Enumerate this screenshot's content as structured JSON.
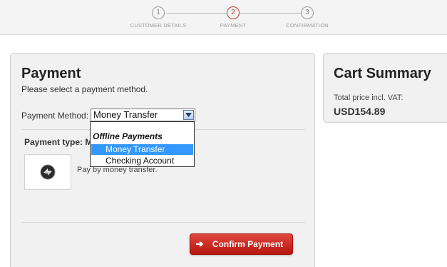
{
  "steps": [
    {
      "number": "1",
      "label": "CUSTOMER DETAILS"
    },
    {
      "number": "2",
      "label": "PAYMENT"
    },
    {
      "number": "3",
      "label": "CONFIRMATION"
    }
  ],
  "active_step": "2",
  "payment": {
    "title": "Payment",
    "subtitle": "Please select a payment method.",
    "method_label": "Payment Method:",
    "selected_method": "Money Transfer",
    "dropdown": {
      "group_label": "Offline Payments",
      "options": [
        "Money Transfer",
        "Checking Account"
      ],
      "highlighted": "Money Transfer"
    },
    "payment_type_label": "Payment type: M",
    "payment_type_desc": "Pay by money transfer.",
    "confirm_label": "Confirm Payment"
  },
  "cart": {
    "title": "Cart Summary",
    "total_label": "Total price incl. VAT:",
    "total_value": "USD154.89"
  },
  "colors": {
    "accent_red": "#c0392b",
    "button_red": "#d3261f",
    "highlight_blue": "#3399ff"
  },
  "icons": [
    "arrow-right-icon",
    "money-transfer-icon",
    "chevron-down-icon"
  ]
}
